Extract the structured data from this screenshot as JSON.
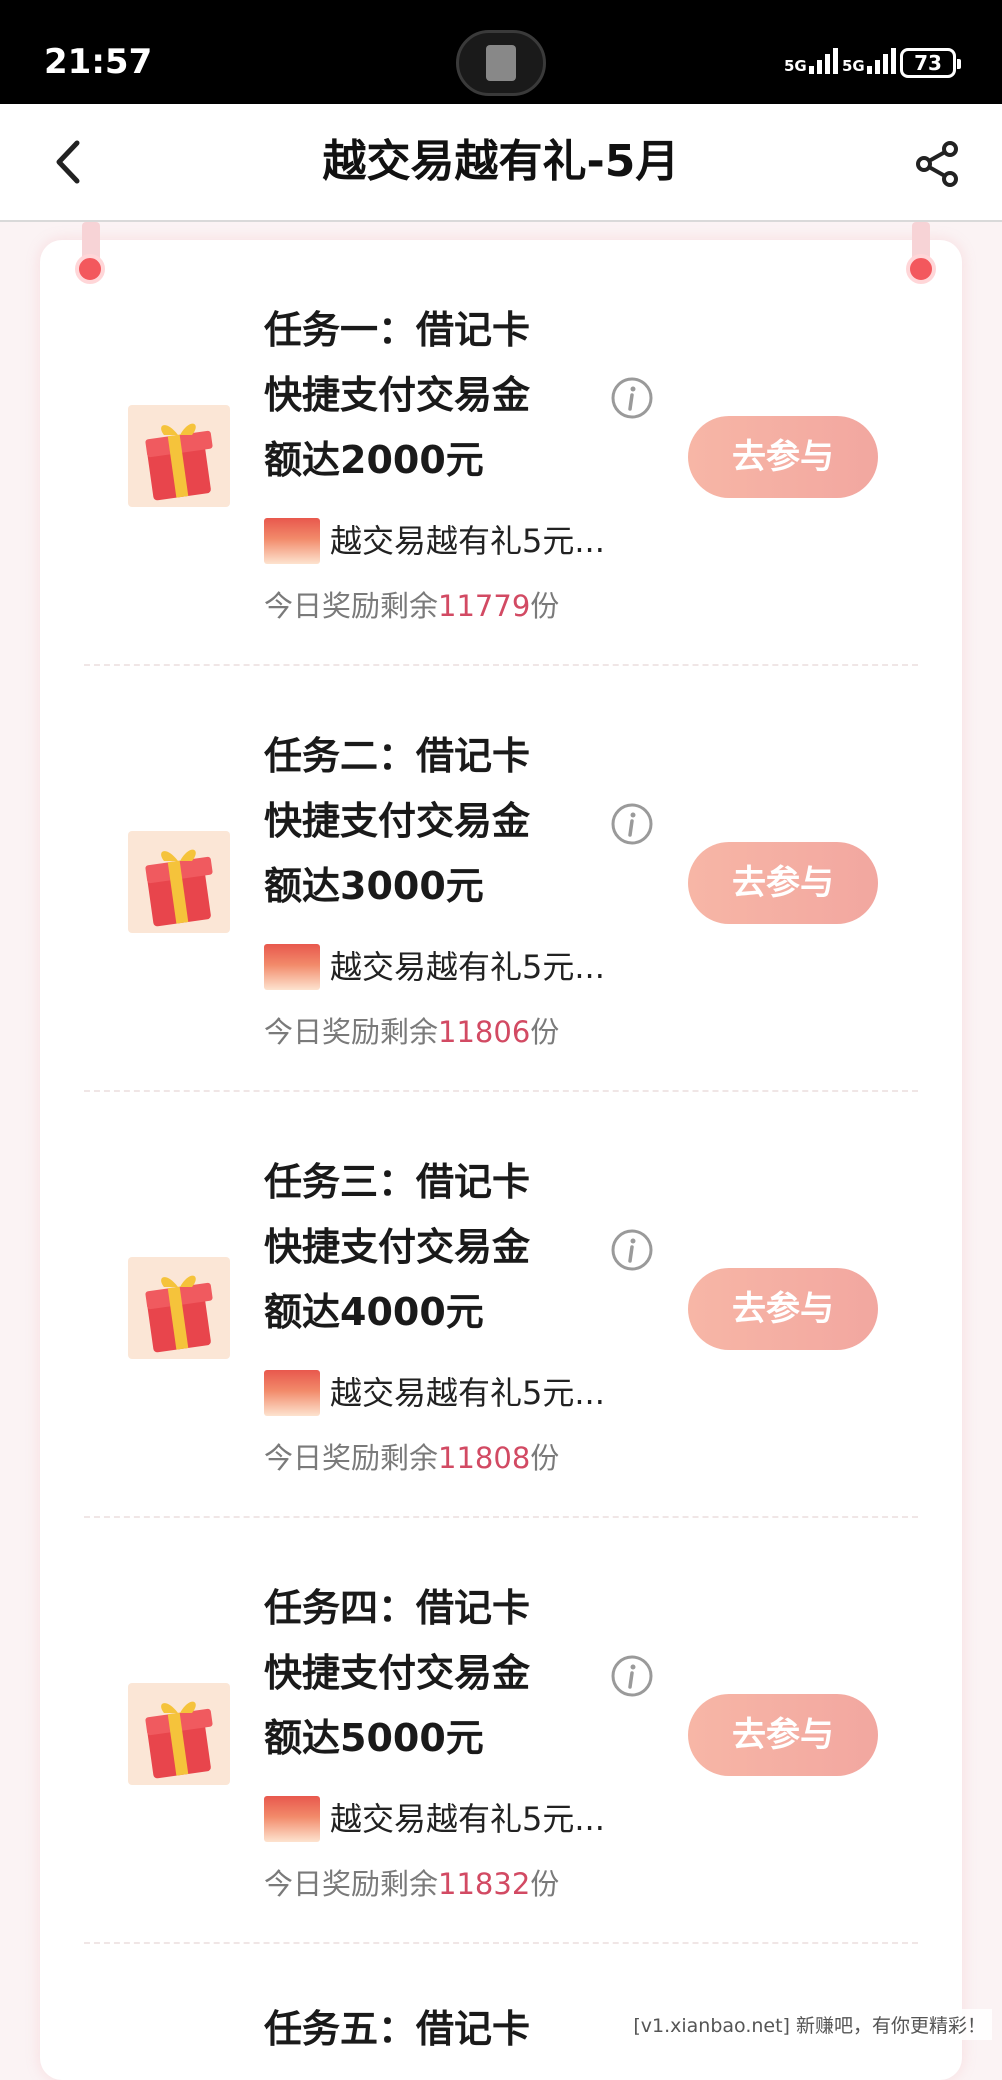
{
  "status_bar": {
    "time": "21:57",
    "network_1": "5G",
    "network_2": "5G",
    "battery": "73"
  },
  "nav": {
    "title": "越交易越有礼-5月",
    "back_icon": "back-chevron-icon",
    "share_icon": "share-icon"
  },
  "tasks": [
    {
      "title_line1": "任务一：借记卡",
      "title_line2": "快捷支付交易金",
      "title_line3": "额达2000元",
      "reward": "越交易越有礼5元...",
      "remaining_prefix": "今日奖励剩余",
      "remaining_count": "11779",
      "remaining_suffix": "份",
      "button": "去参与"
    },
    {
      "title_line1": "任务二：借记卡",
      "title_line2": "快捷支付交易金",
      "title_line3": "额达3000元",
      "reward": "越交易越有礼5元...",
      "remaining_prefix": "今日奖励剩余",
      "remaining_count": "11806",
      "remaining_suffix": "份",
      "button": "去参与"
    },
    {
      "title_line1": "任务三：借记卡",
      "title_line2": "快捷支付交易金",
      "title_line3": "额达4000元",
      "reward": "越交易越有礼5元...",
      "remaining_prefix": "今日奖励剩余",
      "remaining_count": "11808",
      "remaining_suffix": "份",
      "button": "去参与"
    },
    {
      "title_line1": "任务四：借记卡",
      "title_line2": "快捷支付交易金",
      "title_line3": "额达5000元",
      "reward": "越交易越有礼5元...",
      "remaining_prefix": "今日奖励剩余",
      "remaining_count": "11832",
      "remaining_suffix": "份",
      "button": "去参与"
    }
  ],
  "partial_task": {
    "title_line1": "任务五：借记卡"
  },
  "watermark": "[v1.xianbao.net] 新赚吧，有你更精彩！",
  "colors": {
    "accent": "#f3585d",
    "count_highlight": "#d24a63",
    "button_gradient_start": "#f7b6a6",
    "button_gradient_end": "#f2a7a0"
  }
}
